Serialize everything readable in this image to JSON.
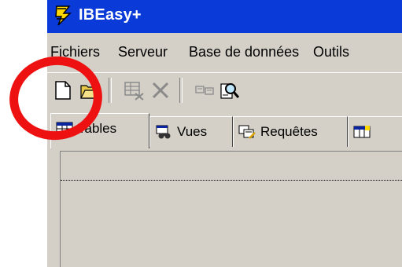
{
  "window": {
    "title": "IBEasy+",
    "icon": "lightning-icon"
  },
  "menu": {
    "items": [
      {
        "label": "Fichiers"
      },
      {
        "label": "Serveur"
      },
      {
        "label": "Base de données"
      },
      {
        "label": "Outils"
      }
    ]
  },
  "toolbar": {
    "buttons": [
      {
        "name": "new-document-icon"
      },
      {
        "name": "open-folder-icon"
      },
      {
        "name": "edit-table-icon"
      },
      {
        "name": "delete-icon"
      },
      {
        "name": "properties-icon"
      },
      {
        "name": "search-icon"
      }
    ]
  },
  "tabs": [
    {
      "label": "Tables",
      "icon": "table-icon",
      "active": true
    },
    {
      "label": "Vues",
      "icon": "binoculars-icon",
      "active": false
    },
    {
      "label": "Requêtes",
      "icon": "query-icon",
      "active": false
    },
    {
      "label": "",
      "icon": "more-icon",
      "active": false
    }
  ],
  "annotation": {
    "color": "#ee1111",
    "target": "new-document-button"
  },
  "colors": {
    "titlebar": "#0a3bd8",
    "chrome": "#d4d0c8"
  }
}
